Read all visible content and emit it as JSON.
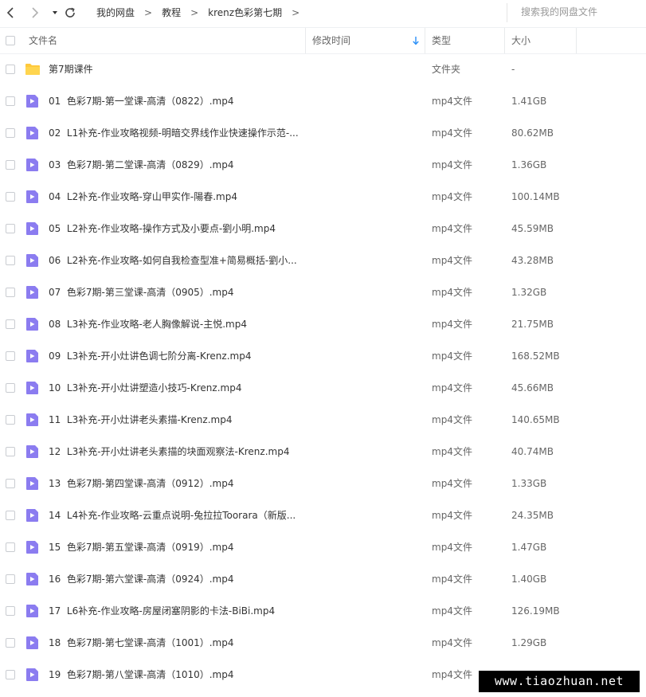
{
  "toolbar": {
    "back_icon": "chevron-left-icon",
    "forward_icon": "chevron-right-icon",
    "dropdown_icon": "caret-down-icon",
    "refresh_icon": "refresh-icon",
    "breadcrumbs": [
      "我的网盘",
      "教程",
      "krenz色彩第七期"
    ],
    "separator": ">",
    "search_placeholder": "搜索我的网盘文件"
  },
  "columns": {
    "name": "文件名",
    "modified": "修改时间",
    "sort_icon": "sort-down-arrow-icon",
    "type": "类型",
    "size": "大小"
  },
  "colors": {
    "accent": "#2a8ff7",
    "video_icon": "#8b7cf0",
    "folder_icon": "#ffc93c"
  },
  "files": [
    {
      "name": "第7期课件",
      "type": "文件夹",
      "size": "-",
      "icon": "folder-icon"
    },
    {
      "name": "01  色彩7期-第一堂课-高清（0822）.mp4",
      "type": "mp4文件",
      "size": "1.41GB",
      "icon": "video-file-icon"
    },
    {
      "name": "02  L1补充-作业攻略视频-明暗交界线作业快速操作示范-...",
      "type": "mp4文件",
      "size": "80.62MB",
      "icon": "video-file-icon"
    },
    {
      "name": "03  色彩7期-第二堂课-高清（0829）.mp4",
      "type": "mp4文件",
      "size": "1.36GB",
      "icon": "video-file-icon"
    },
    {
      "name": "04  L2补充-作业攻略-穿山甲实作-陽春.mp4",
      "type": "mp4文件",
      "size": "100.14MB",
      "icon": "video-file-icon"
    },
    {
      "name": "05  L2补充-作业攻略-操作方式及小要点-劉小明.mp4",
      "type": "mp4文件",
      "size": "45.59MB",
      "icon": "video-file-icon"
    },
    {
      "name": "06  L2补充-作业攻略-如何自我检查型准+简易概括-劉小...",
      "type": "mp4文件",
      "size": "43.28MB",
      "icon": "video-file-icon"
    },
    {
      "name": "07  色彩7期-第三堂课-高清（0905）.mp4",
      "type": "mp4文件",
      "size": "1.32GB",
      "icon": "video-file-icon"
    },
    {
      "name": "08  L3补充-作业攻略-老人胸像解说-主悦.mp4",
      "type": "mp4文件",
      "size": "21.75MB",
      "icon": "video-file-icon"
    },
    {
      "name": "09  L3补充-开小灶讲色调七阶分离-Krenz.mp4",
      "type": "mp4文件",
      "size": "168.52MB",
      "icon": "video-file-icon"
    },
    {
      "name": "10  L3补充-开小灶讲塑造小技巧-Krenz.mp4",
      "type": "mp4文件",
      "size": "45.66MB",
      "icon": "video-file-icon"
    },
    {
      "name": "11  L3补充-开小灶讲老头素描-Krenz.mp4",
      "type": "mp4文件",
      "size": "140.65MB",
      "icon": "video-file-icon"
    },
    {
      "name": "12  L3补充-开小灶讲老头素描的块面观察法-Krenz.mp4",
      "type": "mp4文件",
      "size": "40.74MB",
      "icon": "video-file-icon"
    },
    {
      "name": "13  色彩7期-第四堂课-高清（0912）.mp4",
      "type": "mp4文件",
      "size": "1.33GB",
      "icon": "video-file-icon"
    },
    {
      "name": "14  L4补充-作业攻略-云重点说明-兔拉拉Toorara（新版...",
      "type": "mp4文件",
      "size": "24.35MB",
      "icon": "video-file-icon"
    },
    {
      "name": "15  色彩7期-第五堂课-高清（0919）.mp4",
      "type": "mp4文件",
      "size": "1.47GB",
      "icon": "video-file-icon"
    },
    {
      "name": "16  色彩7期-第六堂课-高清（0924）.mp4",
      "type": "mp4文件",
      "size": "1.40GB",
      "icon": "video-file-icon"
    },
    {
      "name": "17  L6补充-作业攻略-房屋闭塞阴影的卡法-BiBi.mp4",
      "type": "mp4文件",
      "size": "126.19MB",
      "icon": "video-file-icon"
    },
    {
      "name": "18  色彩7期-第七堂课-高清（1001）.mp4",
      "type": "mp4文件",
      "size": "1.29GB",
      "icon": "video-file-icon"
    },
    {
      "name": "19  色彩7期-第八堂课-高清（1010）.mp4",
      "type": "mp4文件",
      "size": "",
      "icon": "video-file-icon"
    }
  ],
  "watermark": "www.tiaozhuan.net"
}
